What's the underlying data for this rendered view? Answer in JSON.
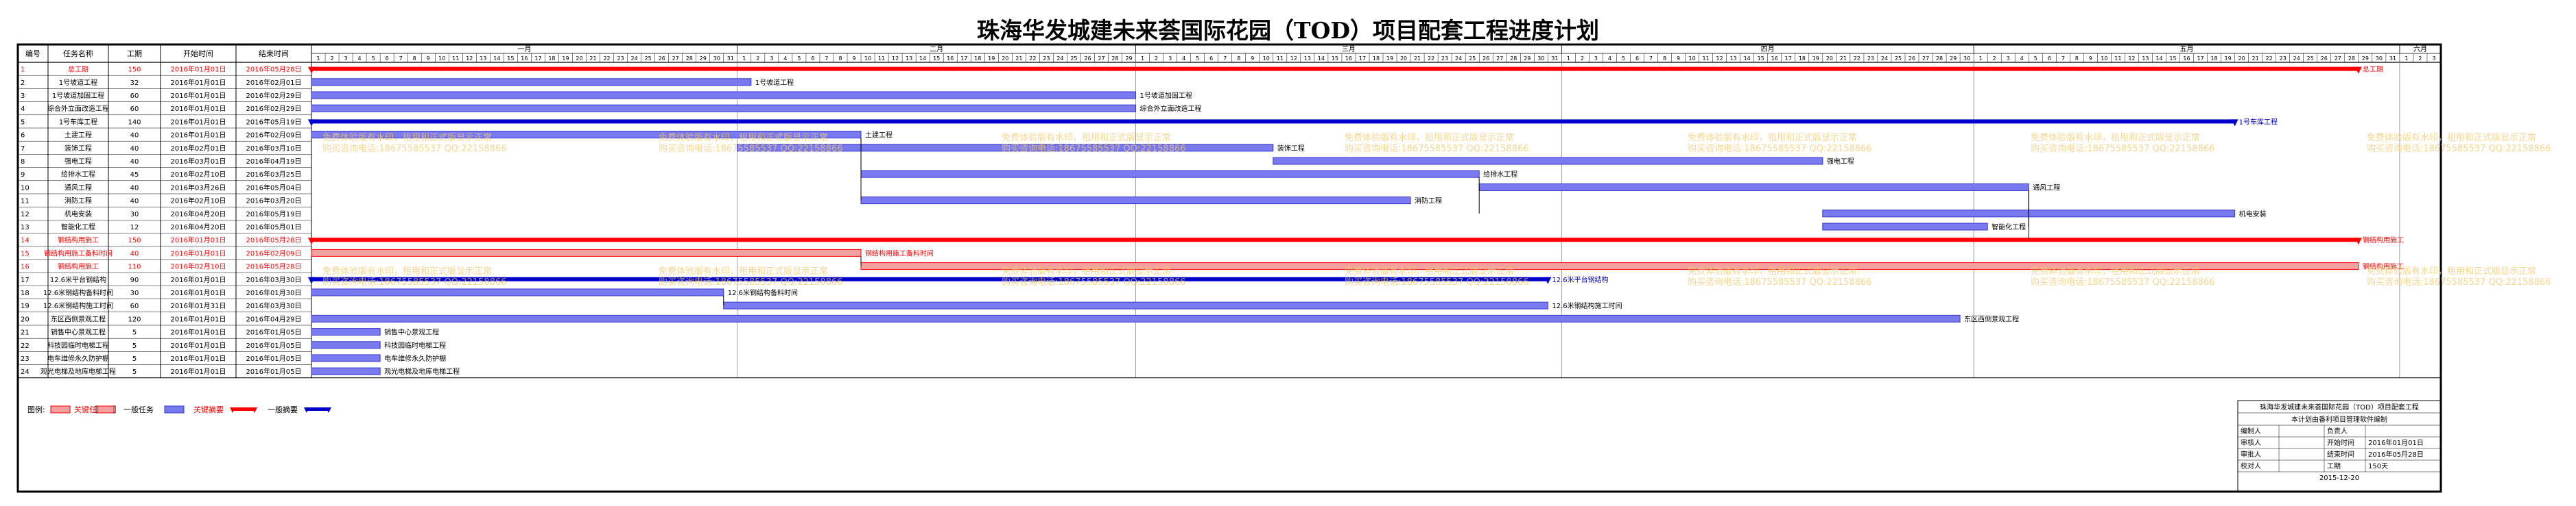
{
  "page": {
    "title": "珠海华发城建未来荟国际花园（TOD）项目配套工程进度计划"
  },
  "table_headers": {
    "id": "编号",
    "name": "任务名称",
    "dur": "工期",
    "start": "开始时间",
    "end": "结束时间"
  },
  "watermark": {
    "line1": "免费体验版有水印，租用和正式版显示正常",
    "line2": "购买咨询电话:18675585537 QQ:22158866"
  },
  "legend": {
    "label": "图例:",
    "critical": "关键任务",
    "normal": "一般任务",
    "critical_summary": "关键摘要",
    "normal_summary": "一般摘要"
  },
  "info_box": {
    "title": "珠海华发城建未来荟国际花园（TOD）项目配套工程",
    "subtitle": "本计划由番利项目管理软件编制",
    "rows": [
      [
        "编制人",
        "",
        "负责人",
        ""
      ],
      [
        "审核人",
        "",
        "开始时间",
        "2016年01月01日"
      ],
      [
        "审批人",
        "",
        "结束时间",
        "2016年05月28日"
      ],
      [
        "校对人",
        "",
        "工期",
        "150天"
      ]
    ],
    "date": "2015-12-20"
  },
  "colors": {
    "critical_red": "#ff0000",
    "normal_blue": "#7a7af0",
    "summary_blue": "#0000cc",
    "critical_bar_fill": "#f2a0a0",
    "watermark": "#f2c96b"
  },
  "chart_data": {
    "type": "gantt",
    "timescale": {
      "start": "2016-01-01",
      "end": "2016-06-03",
      "months": [
        "一月",
        "二月",
        "三月",
        "四月",
        "五月",
        "六月"
      ]
    },
    "tasks": [
      {
        "id": "1",
        "name": "总工期",
        "dur": "150",
        "start": "2016年01月01日",
        "end": "2016年05月28日",
        "s": "2016-01-01",
        "e": "2016-05-28",
        "kind": "critical_summary",
        "label": "总工期"
      },
      {
        "id": "2",
        "name": "1号坡道工程",
        "dur": "32",
        "start": "2016年01月01日",
        "end": "2016年02月01日",
        "s": "2016-01-01",
        "e": "2016-02-01",
        "kind": "task",
        "label": "1号坡道工程"
      },
      {
        "id": "3",
        "name": "1号坡道加固工程",
        "dur": "60",
        "start": "2016年01月01日",
        "end": "2016年02月29日",
        "s": "2016-01-01",
        "e": "2016-02-29",
        "kind": "task",
        "label": "1号坡道加固工程"
      },
      {
        "id": "4",
        "name": "综合外立面改造工程",
        "dur": "60",
        "start": "2016年01月01日",
        "end": "2016年02月29日",
        "s": "2016-01-01",
        "e": "2016-02-29",
        "kind": "task",
        "label": "综合外立面改造工程"
      },
      {
        "id": "5",
        "name": "1号车库工程",
        "dur": "140",
        "start": "2016年01月01日",
        "end": "2016年05月19日",
        "s": "2016-01-01",
        "e": "2016-05-19",
        "kind": "summary",
        "label": "1号车库工程"
      },
      {
        "id": "6",
        "name": "土建工程",
        "dur": "40",
        "start": "2016年01月01日",
        "end": "2016年02月09日",
        "s": "2016-01-01",
        "e": "2016-02-09",
        "kind": "task",
        "label": "土建工程"
      },
      {
        "id": "7",
        "name": "装饰工程",
        "dur": "40",
        "start": "2016年02月01日",
        "end": "2016年03月10日",
        "s": "2016-02-01",
        "e": "2016-03-10",
        "kind": "task",
        "label": "装饰工程"
      },
      {
        "id": "8",
        "name": "强电工程",
        "dur": "40",
        "start": "2016年03月01日",
        "end": "2016年04月19日",
        "s": "2016-03-11",
        "e": "2016-04-19",
        "kind": "task",
        "label": "强电工程"
      },
      {
        "id": "9",
        "name": "给排水工程",
        "dur": "45",
        "start": "2016年02月10日",
        "end": "2016年03月25日",
        "s": "2016-02-10",
        "e": "2016-03-25",
        "kind": "task",
        "label": "给排水工程"
      },
      {
        "id": "10",
        "name": "通风工程",
        "dur": "40",
        "start": "2016年03月26日",
        "end": "2016年05月04日",
        "s": "2016-03-26",
        "e": "2016-05-04",
        "kind": "task",
        "label": "通风工程"
      },
      {
        "id": "11",
        "name": "消防工程",
        "dur": "40",
        "start": "2016年02月10日",
        "end": "2016年03月20日",
        "s": "2016-02-10",
        "e": "2016-03-20",
        "kind": "task",
        "label": "消防工程"
      },
      {
        "id": "12",
        "name": "机电安装",
        "dur": "30",
        "start": "2016年04月20日",
        "end": "2016年05月19日",
        "s": "2016-04-20",
        "e": "2016-05-19",
        "kind": "task",
        "label": "机电安装"
      },
      {
        "id": "13",
        "name": "智能化工程",
        "dur": "12",
        "start": "2016年04月20日",
        "end": "2016年05月01日",
        "s": "2016-04-20",
        "e": "2016-05-01",
        "kind": "task",
        "label": "智能化工程"
      },
      {
        "id": "14",
        "name": "钢结构用施工",
        "dur": "150",
        "start": "2016年01月01日",
        "end": "2016年05月28日",
        "s": "2016-01-01",
        "e": "2016-05-28",
        "kind": "critical_summary",
        "label": "钢结构用施工"
      },
      {
        "id": "15",
        "name": "钢结构用施工备料时间",
        "dur": "40",
        "start": "2016年01月01日",
        "end": "2016年02月09日",
        "s": "2016-01-01",
        "e": "2016-02-09",
        "kind": "critical",
        "label": "钢结构用施工备料时间"
      },
      {
        "id": "16",
        "name": "钢结构用施工",
        "dur": "110",
        "start": "2016年02月10日",
        "end": "2016年05月28日",
        "s": "2016-02-10",
        "e": "2016-05-28",
        "kind": "critical",
        "label": "钢结构用施工"
      },
      {
        "id": "17",
        "name": "12.6米平台钢结构",
        "dur": "90",
        "start": "2016年01月01日",
        "end": "2016年03月30日",
        "s": "2016-01-01",
        "e": "2016-03-30",
        "kind": "summary",
        "label": "12.6米平台钢结构"
      },
      {
        "id": "18",
        "name": "12.6米钢结构备料时间",
        "dur": "30",
        "start": "2016年01月01日",
        "end": "2016年01月30日",
        "s": "2016-01-01",
        "e": "2016-01-30",
        "kind": "task",
        "label": "12.6米钢结构备料时间"
      },
      {
        "id": "19",
        "name": "12.6米钢结构施工时间",
        "dur": "60",
        "start": "2016年01月31日",
        "end": "2016年03月30日",
        "s": "2016-01-31",
        "e": "2016-03-30",
        "kind": "task",
        "label": "12.6米钢结构施工时间"
      },
      {
        "id": "20",
        "name": "东区西侧景观工程",
        "dur": "120",
        "start": "2016年01月01日",
        "end": "2016年04月29日",
        "s": "2016-01-01",
        "e": "2016-04-29",
        "kind": "task",
        "label": "东区西侧景观工程"
      },
      {
        "id": "21",
        "name": "销售中心景观工程",
        "dur": "5",
        "start": "2016年01月01日",
        "end": "2016年01月05日",
        "s": "2016-01-01",
        "e": "2016-01-05",
        "kind": "task",
        "label": "销售中心景观工程"
      },
      {
        "id": "22",
        "name": "科技园临时电梯工程",
        "dur": "5",
        "start": "2016年01月01日",
        "end": "2016年01月05日",
        "s": "2016-01-01",
        "e": "2016-01-05",
        "kind": "task",
        "label": "科技园临时电梯工程"
      },
      {
        "id": "23",
        "name": "电车维修永久防护棚",
        "dur": "5",
        "start": "2016年01月01日",
        "end": "2016年01月05日",
        "s": "2016-01-01",
        "e": "2016-01-05",
        "kind": "task",
        "label": "电车维修永久防护棚"
      },
      {
        "id": "24",
        "name": "观光电梯及地库电梯工程",
        "dur": "5",
        "start": "2016年01月01日",
        "end": "2016年01月05日",
        "s": "2016-01-01",
        "e": "2016-01-05",
        "kind": "task",
        "label": "观光电梯及地库电梯工程"
      }
    ]
  }
}
